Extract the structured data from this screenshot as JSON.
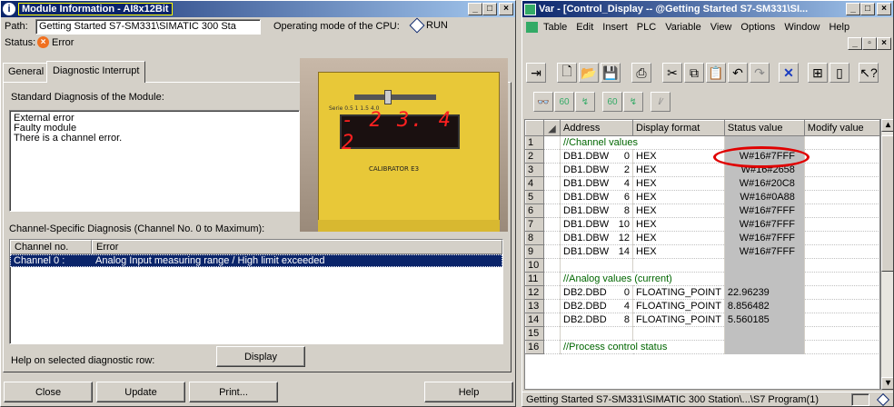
{
  "left": {
    "title": "Module Information - AI8x12Bit",
    "path_label": "Path:",
    "path_value": "Getting Started S7-SM331\\SIMATIC 300 Sta",
    "cpu_mode_label": "Operating mode of the CPU:",
    "cpu_mode_value": "RUN",
    "status_label": "Status:",
    "status_value": "Error",
    "tabs": [
      "General",
      "Diagnostic Interrupt"
    ],
    "std_diag_label": "Standard Diagnosis of the Module:",
    "std_diag_lines": [
      "External error",
      "Faulty module",
      "There is a channel error."
    ],
    "calibrator": {
      "digits": "- 2 3. 4 2",
      "label": "CALIBRATOR E3"
    },
    "channel_diag_label": "Channel-Specific Diagnosis (Channel No. 0 to Maximum):",
    "channel_headers": [
      "Channel no.",
      "Error"
    ],
    "channel_rows": [
      {
        "channel": "Channel  0 :",
        "error": "Analog Input measuring range / High limit exceeded"
      }
    ],
    "help_label": "Help on selected diagnostic row:",
    "display_button": "Display",
    "buttons": {
      "close": "Close",
      "update": "Update",
      "print": "Print...",
      "help": "Help"
    }
  },
  "right": {
    "title": "Var - [Control_Display -- @Getting Started S7-SM331\\SI...",
    "menu": [
      "Table",
      "Edit",
      "Insert",
      "PLC",
      "Variable",
      "View",
      "Options",
      "Window",
      "Help"
    ],
    "headers": [
      "Address",
      "Display format",
      "Status value",
      "Modify value"
    ],
    "rows": [
      {
        "n": "1",
        "comment": "//Channel values"
      },
      {
        "n": "2",
        "addr": "DB1.DBW",
        "off": "0",
        "fmt": "HEX",
        "val": "W#16#7FFF"
      },
      {
        "n": "3",
        "addr": "DB1.DBW",
        "off": "2",
        "fmt": "HEX",
        "val": "W#16#2658"
      },
      {
        "n": "4",
        "addr": "DB1.DBW",
        "off": "4",
        "fmt": "HEX",
        "val": "W#16#20C8"
      },
      {
        "n": "5",
        "addr": "DB1.DBW",
        "off": "6",
        "fmt": "HEX",
        "val": "W#16#0A88"
      },
      {
        "n": "6",
        "addr": "DB1.DBW",
        "off": "8",
        "fmt": "HEX",
        "val": "W#16#7FFF"
      },
      {
        "n": "7",
        "addr": "DB1.DBW",
        "off": "10",
        "fmt": "HEX",
        "val": "W#16#7FFF"
      },
      {
        "n": "8",
        "addr": "DB1.DBW",
        "off": "12",
        "fmt": "HEX",
        "val": "W#16#7FFF"
      },
      {
        "n": "9",
        "addr": "DB1.DBW",
        "off": "14",
        "fmt": "HEX",
        "val": "W#16#7FFF"
      },
      {
        "n": "10"
      },
      {
        "n": "11",
        "comment": "//Analog values (current)"
      },
      {
        "n": "12",
        "addr": "DB2.DBD",
        "off": "0",
        "fmt": "FLOATING_POINT",
        "val": "22.96239"
      },
      {
        "n": "13",
        "addr": "DB2.DBD",
        "off": "4",
        "fmt": "FLOATING_POINT",
        "val": "8.856482"
      },
      {
        "n": "14",
        "addr": "DB2.DBD",
        "off": "8",
        "fmt": "FLOATING_POINT",
        "val": "5.560185"
      },
      {
        "n": "15"
      },
      {
        "n": "16",
        "comment": "//Process control status"
      }
    ],
    "statusbar": "Getting Started S7-SM331\\SIMATIC 300 Station\\...\\S7 Program(1)"
  },
  "colors": {
    "highlight_ring": "#e00000",
    "selection": "#0a246a",
    "comment": "#006600"
  }
}
